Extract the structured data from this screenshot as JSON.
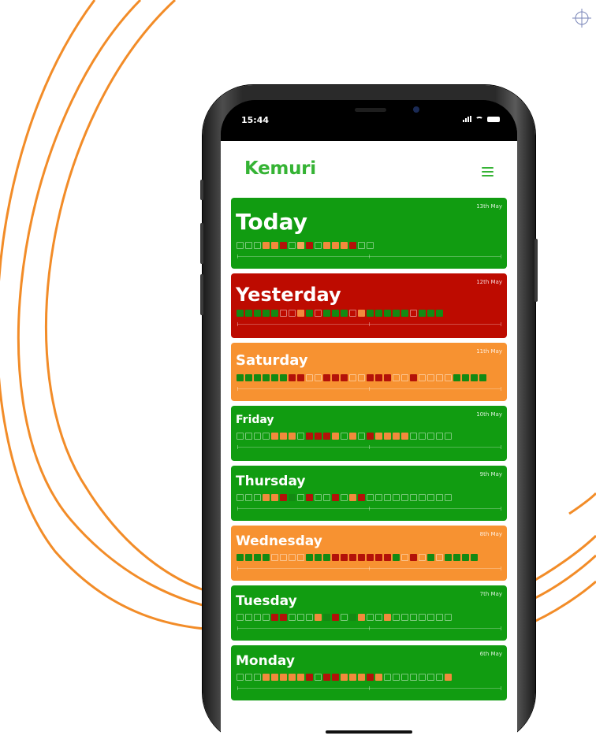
{
  "status_bar": {
    "time": "15:44"
  },
  "app": {
    "logo": "Kemuri"
  },
  "colors": {
    "green": "#119c11",
    "red": "#bd0b00",
    "orange": "#f79231",
    "brand": "#35b334",
    "arc": "#f28c28"
  },
  "days": [
    {
      "name": "Today",
      "date": "13th May",
      "color": "green",
      "slots": "eeeooreyreoooree"
    },
    {
      "name": "Yesterday",
      "date": "12th May",
      "color": "red",
      "slots": "gggggeeogegggeogggggeggg"
    },
    {
      "name": "Saturday",
      "date": "11th May",
      "color": "orange",
      "slots": "ggggggrreerrreerrreereeeegggg"
    },
    {
      "name": "Friday",
      "date": "10th May",
      "color": "green",
      "slots": "eeeeoooerrroeoerooooeeeee"
    },
    {
      "name": "Thursday",
      "date": "9th May",
      "color": "green",
      "slots": "eeeoorgereereoreeeeeeeeee"
    },
    {
      "name": "Wednesday",
      "date": "8th May",
      "color": "orange",
      "slots": "ggggeeeegggrrrrrrrgeregegggg"
    },
    {
      "name": "Tuesday",
      "date": "7th May",
      "color": "green",
      "slots": "eeeerreeeogregoeeoeeeeeee"
    },
    {
      "name": "Monday",
      "date": "6th May",
      "color": "green",
      "slots": "eeeooooorerroooroeeeeeeeo"
    }
  ]
}
